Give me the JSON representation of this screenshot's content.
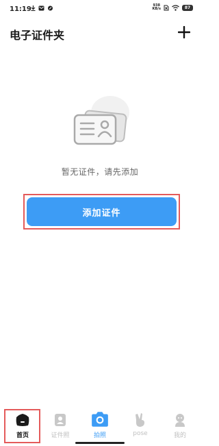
{
  "status_bar": {
    "time": "11:19",
    "net_speed_value": "938",
    "net_speed_unit": "KB/s",
    "battery": "87"
  },
  "header": {
    "title": "电子证件夹",
    "add_icon": "plus-icon"
  },
  "empty_state": {
    "illustration_icon": "id-card-icon",
    "message": "暂无证件，请先添加"
  },
  "add_button": {
    "label": "添加证件"
  },
  "tabbar": {
    "tabs": [
      {
        "label": "首页",
        "icon": "home-icon",
        "active": true
      },
      {
        "label": "证件照",
        "icon": "id-photo-icon",
        "active": false
      },
      {
        "label": "拍照",
        "icon": "camera-icon",
        "active": false
      },
      {
        "label": "pose",
        "icon": "hand-pose-icon",
        "active": false
      },
      {
        "label": "我的",
        "icon": "profile-icon",
        "active": false
      }
    ]
  },
  "colors": {
    "accent": "#3d9cf5",
    "highlight_box": "#e45a5a"
  }
}
